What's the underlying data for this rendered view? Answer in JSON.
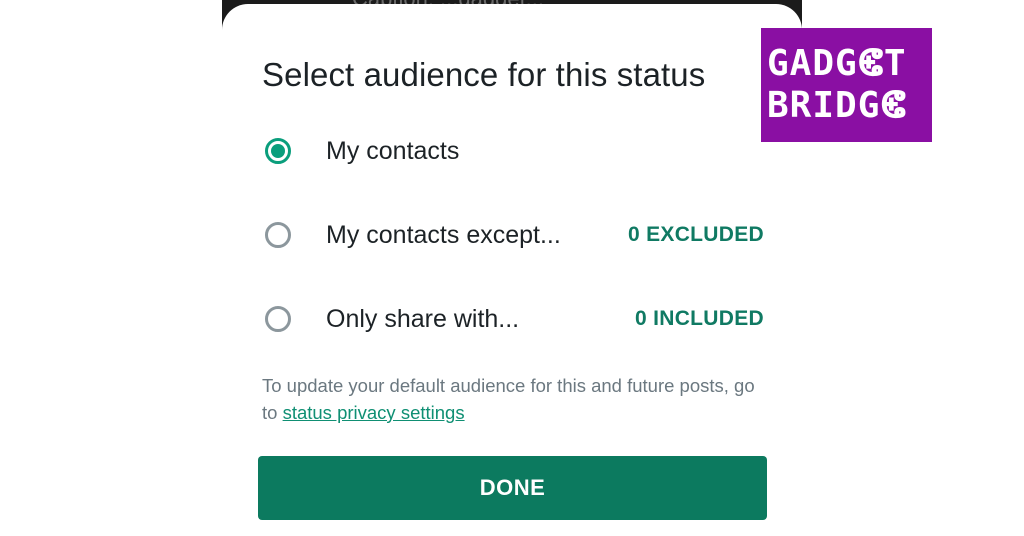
{
  "background": {
    "partial_text": "Caption. ...gadget..."
  },
  "dialog": {
    "title": "Select audience for this status",
    "options": [
      {
        "label": "My contacts",
        "count": "",
        "selected": true
      },
      {
        "label": "My contacts except...",
        "count": "0 EXCLUDED",
        "selected": false
      },
      {
        "label": "Only share with...",
        "count": "0 INCLUDED",
        "selected": false
      }
    ],
    "footnote_text": "To update your default audience for this and future posts, go to ",
    "footnote_link": "status privacy settings",
    "done_label": "DONE"
  },
  "watermark": {
    "line1": "GADGⵞT",
    "line2": "BRIDGⵞ",
    "color": "#8a0fa3"
  },
  "colors": {
    "accent": "#0a9e7c",
    "button": "#0c7a5f",
    "count_text": "#107a63"
  }
}
